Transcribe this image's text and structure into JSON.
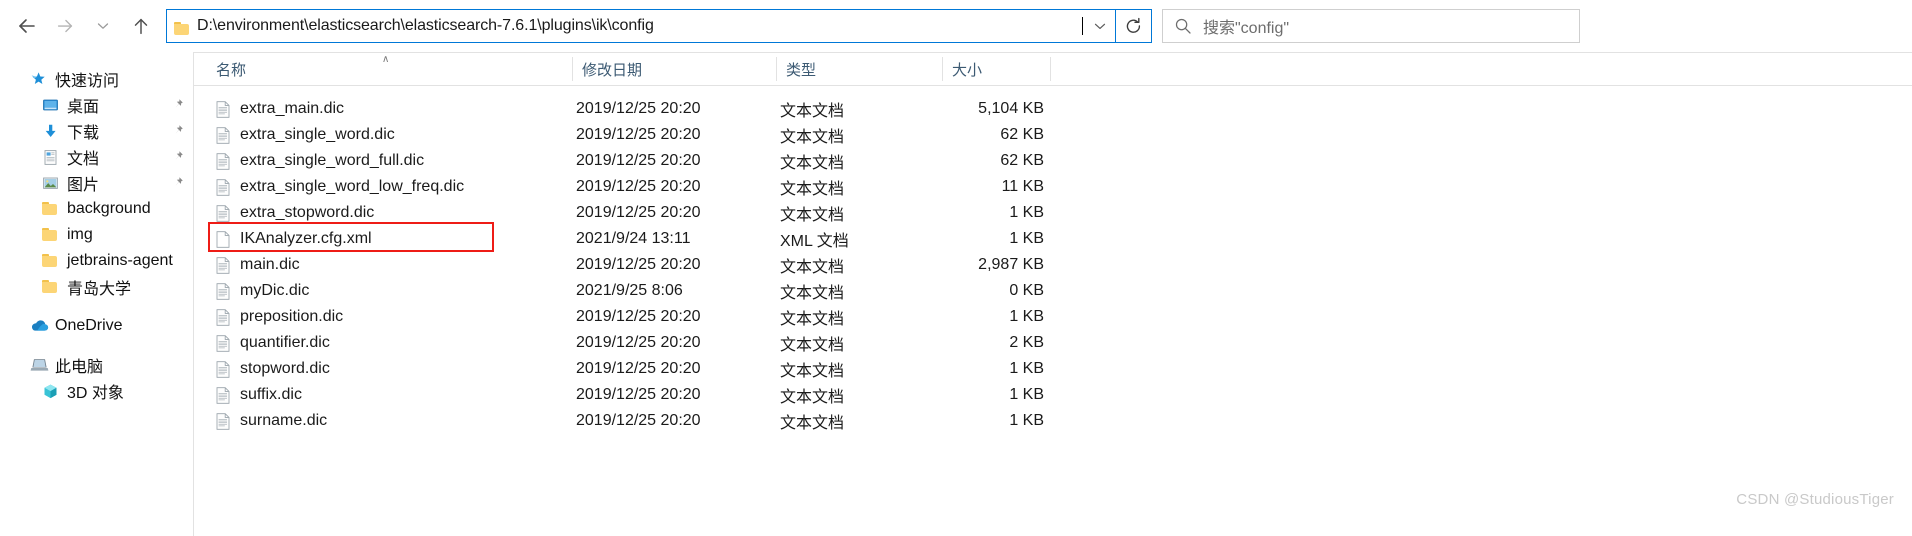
{
  "nav": {
    "back_label": "后退",
    "forward_label": "前进",
    "recent_label": "最近使用的位置",
    "up_label": "上移一级",
    "refresh_label": "刷新",
    "dropdown_label": "以前的位置"
  },
  "address": {
    "path": "D:\\environment\\elasticsearch\\elasticsearch-7.6.1\\plugins\\ik\\config",
    "folder_icon": "folder-icon",
    "dropdown_icon": "chevron-down-icon"
  },
  "search": {
    "placeholder": "搜索\"config\"",
    "value": "",
    "icon": "search-icon"
  },
  "sidebar": {
    "items": [
      {
        "label": "快速访问",
        "icon": "star-icon",
        "level": 0,
        "pinned": false
      },
      {
        "label": "桌面",
        "icon": "desktop-icon",
        "level": 1,
        "pinned": true
      },
      {
        "label": "下载",
        "icon": "download-icon",
        "level": 1,
        "pinned": true
      },
      {
        "label": "文档",
        "icon": "documents-icon",
        "level": 1,
        "pinned": true
      },
      {
        "label": "图片",
        "icon": "pictures-icon",
        "level": 1,
        "pinned": true
      },
      {
        "label": "background",
        "icon": "folder-icon",
        "level": 1,
        "pinned": false
      },
      {
        "label": "img",
        "icon": "folder-icon",
        "level": 1,
        "pinned": false
      },
      {
        "label": "jetbrains-agent",
        "icon": "folder-icon",
        "level": 1,
        "pinned": false
      },
      {
        "label": "青岛大学",
        "icon": "folder-icon",
        "level": 1,
        "pinned": false
      },
      {
        "label": "OneDrive",
        "icon": "onedrive-icon",
        "level": 0,
        "pinned": false
      },
      {
        "label": "此电脑",
        "icon": "this-pc-icon",
        "level": 0,
        "pinned": false
      },
      {
        "label": "3D 对象",
        "icon": "3d-objects-icon",
        "level": 1,
        "pinned": false
      }
    ]
  },
  "file_list": {
    "columns": [
      {
        "key": "name",
        "label": "名称",
        "sorted": true,
        "sort_direction": "asc",
        "sort_glyph": "∧"
      },
      {
        "key": "date",
        "label": "修改日期",
        "sorted": false
      },
      {
        "key": "type",
        "label": "类型",
        "sorted": false
      },
      {
        "key": "size",
        "label": "大小",
        "sorted": false
      }
    ],
    "rows": [
      {
        "name": "extra_main.dic",
        "date": "2019/12/25 20:20",
        "type": "文本文档",
        "size": "5,104 KB",
        "icon": "text-file-icon",
        "highlighted": false
      },
      {
        "name": "extra_single_word.dic",
        "date": "2019/12/25 20:20",
        "type": "文本文档",
        "size": "62 KB",
        "icon": "text-file-icon",
        "highlighted": false
      },
      {
        "name": "extra_single_word_full.dic",
        "date": "2019/12/25 20:20",
        "type": "文本文档",
        "size": "62 KB",
        "icon": "text-file-icon",
        "highlighted": false
      },
      {
        "name": "extra_single_word_low_freq.dic",
        "date": "2019/12/25 20:20",
        "type": "文本文档",
        "size": "11 KB",
        "icon": "text-file-icon",
        "highlighted": false
      },
      {
        "name": "extra_stopword.dic",
        "date": "2019/12/25 20:20",
        "type": "文本文档",
        "size": "1 KB",
        "icon": "text-file-icon",
        "highlighted": false
      },
      {
        "name": "IKAnalyzer.cfg.xml",
        "date": "2021/9/24 13:11",
        "type": "XML 文档",
        "size": "1 KB",
        "icon": "xml-file-icon",
        "highlighted": true
      },
      {
        "name": "main.dic",
        "date": "2019/12/25 20:20",
        "type": "文本文档",
        "size": "2,987 KB",
        "icon": "text-file-icon",
        "highlighted": false
      },
      {
        "name": "myDic.dic",
        "date": "2021/9/25 8:06",
        "type": "文本文档",
        "size": "0 KB",
        "icon": "text-file-icon",
        "highlighted": false
      },
      {
        "name": "preposition.dic",
        "date": "2019/12/25 20:20",
        "type": "文本文档",
        "size": "1 KB",
        "icon": "text-file-icon",
        "highlighted": false
      },
      {
        "name": "quantifier.dic",
        "date": "2019/12/25 20:20",
        "type": "文本文档",
        "size": "2 KB",
        "icon": "text-file-icon",
        "highlighted": false
      },
      {
        "name": "stopword.dic",
        "date": "2019/12/25 20:20",
        "type": "文本文档",
        "size": "1 KB",
        "icon": "text-file-icon",
        "highlighted": false
      },
      {
        "name": "suffix.dic",
        "date": "2019/12/25 20:20",
        "type": "文本文档",
        "size": "1 KB",
        "icon": "text-file-icon",
        "highlighted": false
      },
      {
        "name": "surname.dic",
        "date": "2019/12/25 20:20",
        "type": "文本文档",
        "size": "1 KB",
        "icon": "text-file-icon",
        "highlighted": false
      }
    ]
  },
  "annotation": {
    "highlight_color": "#ee1c16",
    "target_row": "IKAnalyzer.cfg.xml"
  },
  "watermark": {
    "text": "CSDN @StudiousTiger"
  },
  "colors": {
    "accent": "#0078d7",
    "header_text": "#3c5a73",
    "folder_yellow": "#fcd576",
    "highlight_red": "#ee1c16"
  }
}
